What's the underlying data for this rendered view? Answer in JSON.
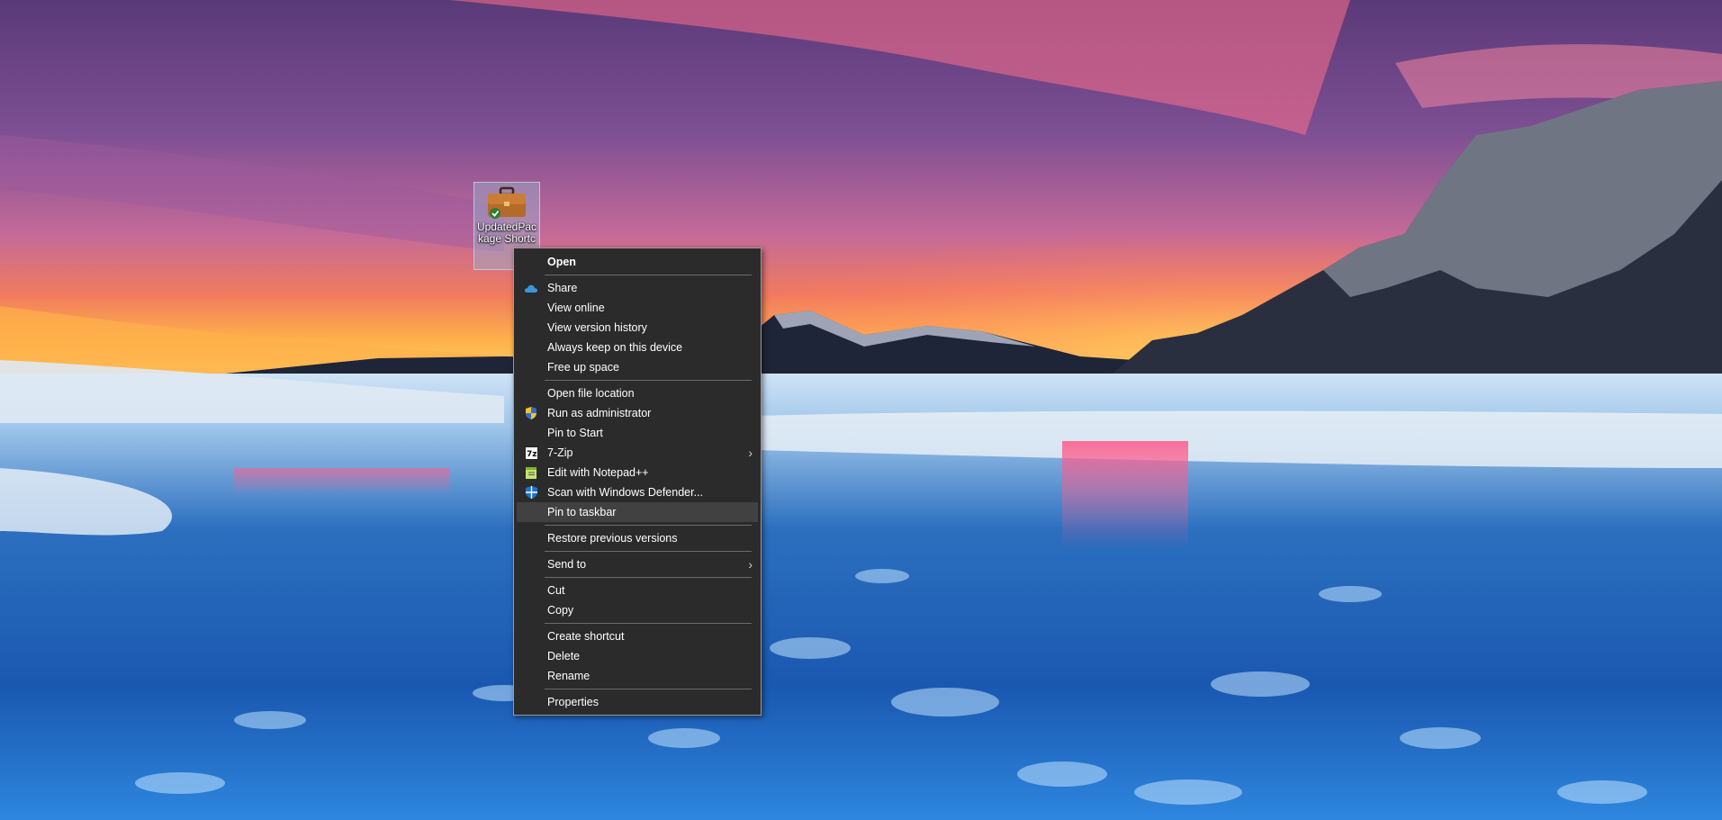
{
  "desktop": {
    "icon": {
      "name": "UpdatedPackage Shortcut",
      "label_visible": "UpdatedPack­age Shortc"
    }
  },
  "context_menu": {
    "groups": [
      [
        {
          "label": "Open",
          "bold": true
        }
      ],
      [
        {
          "label": "Share",
          "icon": "onedrive-cloud-icon"
        },
        {
          "label": "View online"
        },
        {
          "label": "View version history"
        },
        {
          "label": "Always keep on this device"
        },
        {
          "label": "Free up space"
        }
      ],
      [
        {
          "label": "Open file location"
        },
        {
          "label": "Run as administrator",
          "icon": "uac-shield-icon"
        },
        {
          "label": "Pin to Start"
        },
        {
          "label": "7-Zip",
          "icon": "7zip-icon",
          "submenu": true
        },
        {
          "label": "Edit with Notepad++",
          "icon": "notepadpp-icon"
        },
        {
          "label": "Scan with Windows Defender...",
          "icon": "defender-shield-icon"
        },
        {
          "label": "Pin to taskbar",
          "highlighted": true
        }
      ],
      [
        {
          "label": "Restore previous versions"
        }
      ],
      [
        {
          "label": "Send to",
          "submenu": true
        }
      ],
      [
        {
          "label": "Cut"
        },
        {
          "label": "Copy"
        }
      ],
      [
        {
          "label": "Create shortcut"
        },
        {
          "label": "Delete"
        },
        {
          "label": "Rename"
        }
      ],
      [
        {
          "label": "Properties"
        }
      ]
    ]
  },
  "colors": {
    "menu_bg": "#2b2b2b",
    "menu_highlight": "#414141",
    "separator": "#6b6b6b"
  }
}
